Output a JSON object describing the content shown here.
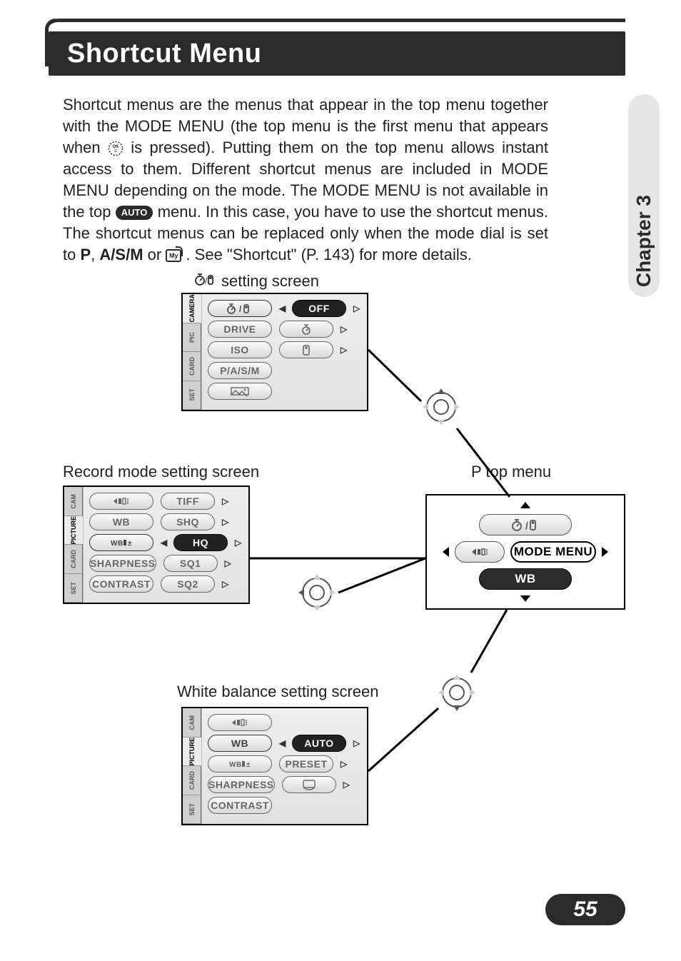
{
  "chapter_tab": "Chapter 3",
  "title": "Shortcut Menu",
  "page_number": "55",
  "body": {
    "t1": "Shortcut menus are the menus that appear in the top menu together with the MODE MENU (the top menu is the first menu that appears when",
    "t2": "is pressed). Putting them on the top menu allows instant access to them. Different shortcut menus are included in MODE MENU depending on the mode. The MODE MENU is not available in the top",
    "t3": "menu. In this case, you have to use the shortcut menus. The shortcut menus can be replaced only when the mode dial is set to",
    "bold1": "P",
    "comma": ", ",
    "bold2": "A/S/M",
    "t4": " or ",
    "t5": ". See \"Shortcut\" (P. 143) for more details.",
    "auto_label": "AUTO",
    "my_label": "My"
  },
  "labels": {
    "timer_screen": "setting screen",
    "record_screen": "Record mode setting screen",
    "p_top_menu": "P top menu",
    "wb_screen": "White balance setting screen"
  },
  "ptop": {
    "top_label_icon": "timer-remote",
    "left_icon": "record-mode",
    "right_label": "MODE MENU",
    "bottom_label": "WB"
  },
  "timer_panel": {
    "tabs": [
      "CAMERA",
      "PIC",
      "CARD",
      "SET"
    ],
    "active_tab": 0,
    "rows": [
      {
        "name_icon": "timer-remote",
        "val": "OFF",
        "selected": true
      },
      {
        "name": "DRIVE",
        "val_icon": "timer"
      },
      {
        "name": "ISO",
        "val_icon": "remote"
      },
      {
        "name": "P/A/S/M"
      },
      {
        "name_icon": "panorama"
      }
    ]
  },
  "record_panel": {
    "tabs": [
      "CAM",
      "PICTURE",
      "CARD",
      "SET"
    ],
    "active_tab": 1,
    "rows": [
      {
        "name_icon": "record-mode",
        "val": "TIFF"
      },
      {
        "name": "WB",
        "val": "SHQ"
      },
      {
        "name_icon": "wb-adjust",
        "val": "HQ",
        "selected": true
      },
      {
        "name": "SHARPNESS",
        "val": "SQ1"
      },
      {
        "name": "CONTRAST",
        "val": "SQ2"
      }
    ]
  },
  "wb_panel": {
    "tabs": [
      "CAM",
      "PICTURE",
      "CARD",
      "SET"
    ],
    "active_tab": 1,
    "rows": [
      {
        "name_icon": "record-mode"
      },
      {
        "name": "WB",
        "val": "AUTO",
        "selected": true
      },
      {
        "name_icon": "wb-adjust",
        "val": "PRESET"
      },
      {
        "name": "SHARPNESS",
        "val_icon": "one-touch"
      },
      {
        "name": "CONTRAST"
      }
    ]
  },
  "chart_data": {
    "type": "diagram",
    "description": "P top menu at center-right branches via d-pad directions to three sub-screens: up to timer/remote setting screen, left to Record mode setting screen, down to White balance setting screen. Right branch leads to MODE MENU.",
    "nodes": [
      {
        "id": "p_top_menu",
        "label": "P top menu"
      },
      {
        "id": "timer_screen",
        "label": "⏲/🔌 setting screen"
      },
      {
        "id": "record_screen",
        "label": "Record mode setting screen"
      },
      {
        "id": "wb_screen",
        "label": "White balance setting screen"
      }
    ],
    "edges": [
      {
        "from": "p_top_menu",
        "to": "timer_screen",
        "via": "up"
      },
      {
        "from": "p_top_menu",
        "to": "record_screen",
        "via": "left"
      },
      {
        "from": "p_top_menu",
        "to": "wb_screen",
        "via": "down"
      }
    ]
  }
}
